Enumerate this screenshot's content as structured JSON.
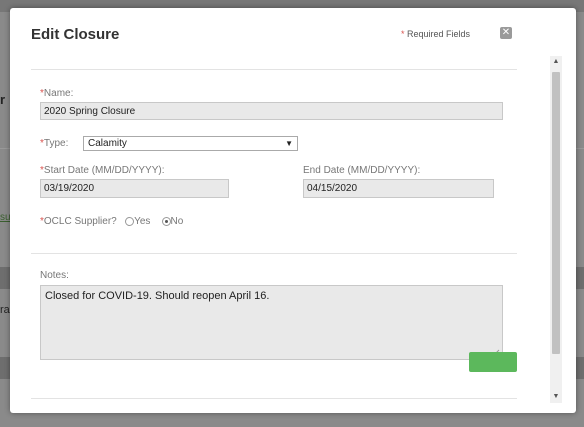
{
  "background": {
    "fragments": [
      "r",
      "ra"
    ],
    "link_fragment": "su"
  },
  "modal": {
    "title": "Edit Closure",
    "required_note_star": "*",
    "required_note": "Required Fields",
    "close_symbol": "✕"
  },
  "form": {
    "name_label": "Name:",
    "name_value": "2020 Spring Closure",
    "type_label": "Type:",
    "type_value": "Calamity",
    "start_date_label": "Start Date (MM/DD/YYYY):",
    "start_date_value": "03/19/2020",
    "end_date_label": "End Date (MM/DD/YYYY):",
    "end_date_value": "04/15/2020",
    "supplier_label": "OCLC Supplier?",
    "supplier_options": [
      "Yes",
      "No"
    ],
    "supplier_selected": "No",
    "notes_label": "Notes:",
    "notes_value": "Closed for COVID-19.  Should reopen April 16."
  },
  "scrollbar": {
    "up_arrow": "▲",
    "down_arrow": "▼"
  },
  "colors": {
    "required_star": "#d9534f",
    "primary_button": "#5cb85c",
    "field_background": "#e9e9e9"
  }
}
